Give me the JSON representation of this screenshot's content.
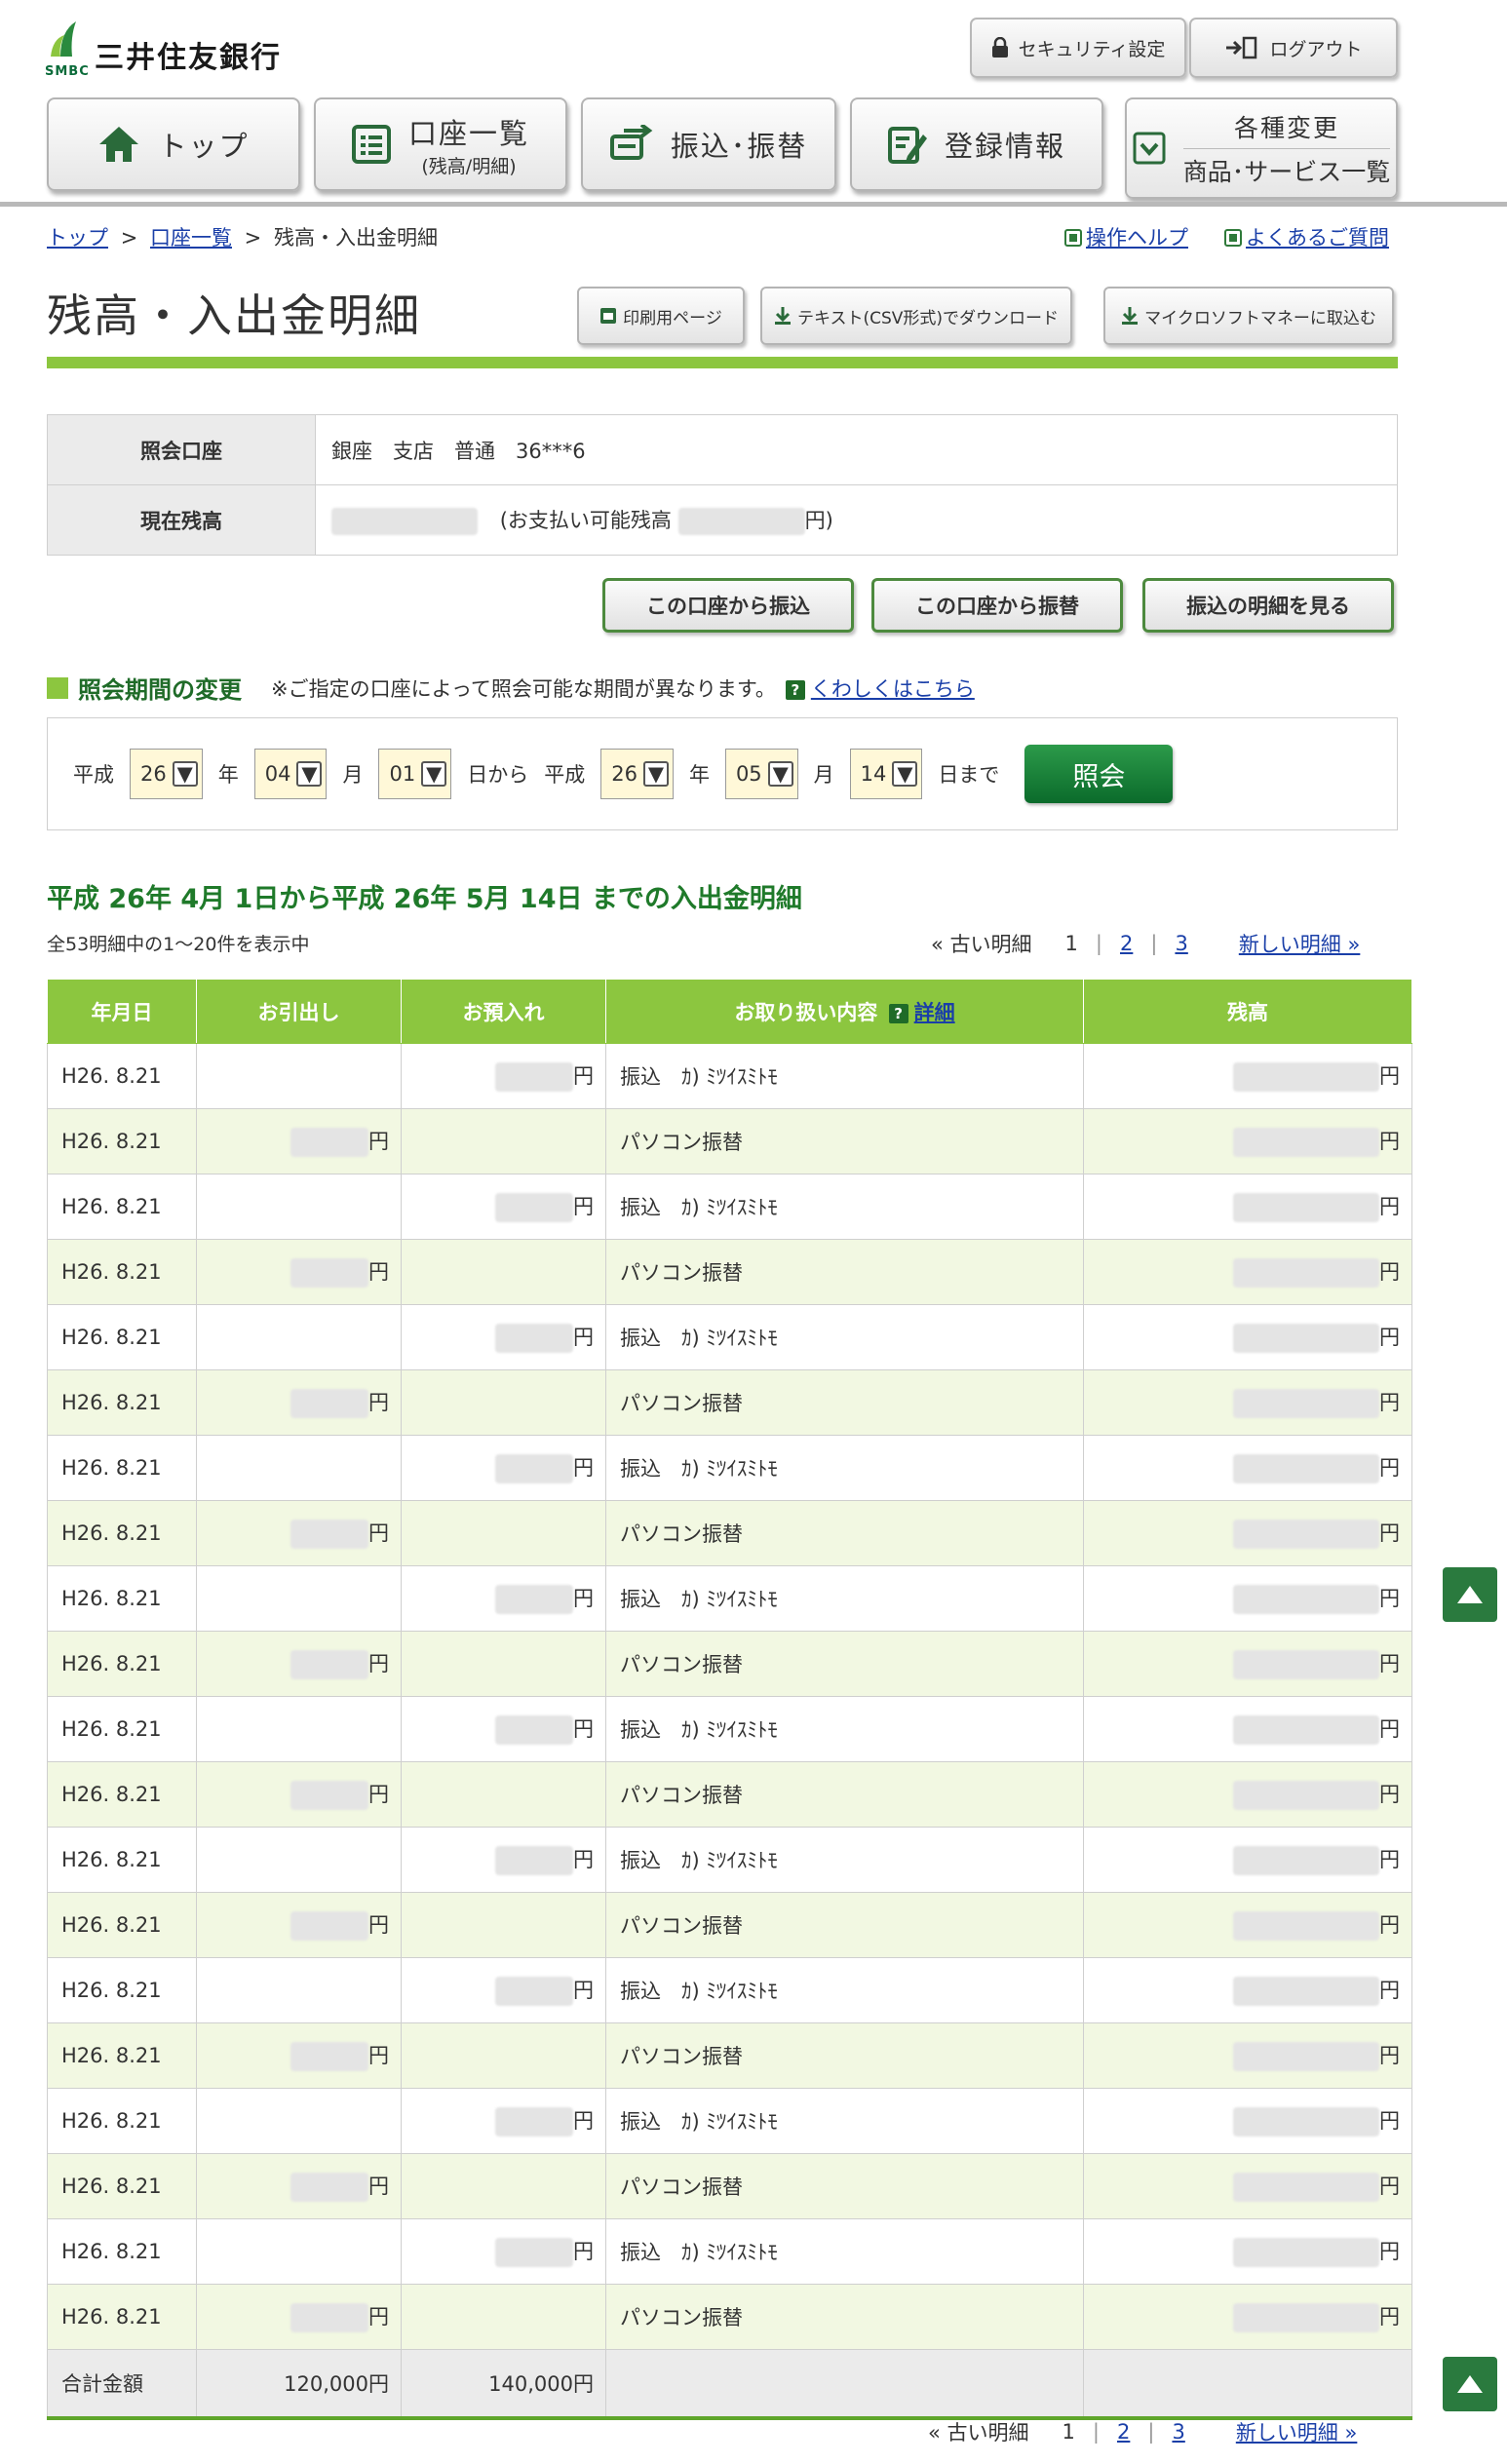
{
  "bank": {
    "name": "三井住友銀行",
    "short": "SMBC"
  },
  "header": {
    "security_label": "セキュリティ設定",
    "logout_label": "ログアウト"
  },
  "nav": {
    "top": "トップ",
    "accounts": "口座一覧",
    "accounts_sub": "(残高/明細)",
    "transfer": "振込･振替",
    "registration": "登録情報",
    "changes": "各種変更",
    "products": "商品･サービス一覧"
  },
  "breadcrumb": {
    "top": "トップ",
    "accounts": "口座一覧",
    "current": "残高・入出金明細",
    "sep": ">"
  },
  "help": {
    "manual": "操作ヘルプ",
    "faq": "よくあるご質問"
  },
  "page": {
    "title": "残高・入出金明細"
  },
  "tools": {
    "print": "印刷用ページ",
    "csv": "テキスト(CSV形式)でダウンロード",
    "money": "マイクロソフトマネーに取込む"
  },
  "account": {
    "account_label": "照会口座",
    "account_value": "銀座　支店　普通　36***6",
    "balance_label": "現在残高",
    "available_prefix": "(お支払い可能残高",
    "available_suffix": "円)"
  },
  "actions": {
    "transfer": "この口座から振込",
    "furikae": "この口座から振替",
    "history": "振込の明細を見る"
  },
  "period": {
    "title": "照会期間の変更",
    "note": "※ご指定の口座によって照会可能な期間が異なります。",
    "help_link": "くわしくはこちら",
    "era": "平成",
    "year_unit": "年",
    "month_unit": "月",
    "from_unit": "日から",
    "to_unit": "日まで",
    "from_year": "26",
    "from_month": "04",
    "from_day": "01",
    "to_year": "26",
    "to_month": "05",
    "to_day": "14",
    "submit": "照会"
  },
  "statement": {
    "title": "平成 26年 4月 1日から平成 26年 5月 14日 までの入出金明細",
    "count": "全53明細中の1～20件を表示中",
    "older": "« 古い明細",
    "newer": "新しい明細 »",
    "pages": [
      "1",
      "2",
      "3"
    ]
  },
  "table": {
    "headers": {
      "date": "年月日",
      "withdraw": "お引出し",
      "deposit": "お預入れ",
      "detail": "お取り扱い内容",
      "detail_link": "詳細",
      "balance": "残高"
    },
    "yen": "円",
    "rows": [
      {
        "date": "H26. 8.21",
        "type": "deposit",
        "desc": "振込　ｶ) ﾐﾂｲｽﾐﾄﾓ"
      },
      {
        "date": "H26. 8.21",
        "type": "withdraw",
        "desc": "パソコン振替"
      },
      {
        "date": "H26. 8.21",
        "type": "deposit",
        "desc": "振込　ｶ) ﾐﾂｲｽﾐﾄﾓ"
      },
      {
        "date": "H26. 8.21",
        "type": "withdraw",
        "desc": "パソコン振替"
      },
      {
        "date": "H26. 8.21",
        "type": "deposit",
        "desc": "振込　ｶ) ﾐﾂｲｽﾐﾄﾓ"
      },
      {
        "date": "H26. 8.21",
        "type": "withdraw",
        "desc": "パソコン振替"
      },
      {
        "date": "H26. 8.21",
        "type": "deposit",
        "desc": "振込　ｶ) ﾐﾂｲｽﾐﾄﾓ"
      },
      {
        "date": "H26. 8.21",
        "type": "withdraw",
        "desc": "パソコン振替"
      },
      {
        "date": "H26. 8.21",
        "type": "deposit",
        "desc": "振込　ｶ) ﾐﾂｲｽﾐﾄﾓ"
      },
      {
        "date": "H26. 8.21",
        "type": "withdraw",
        "desc": "パソコン振替"
      },
      {
        "date": "H26. 8.21",
        "type": "deposit",
        "desc": "振込　ｶ) ﾐﾂｲｽﾐﾄﾓ"
      },
      {
        "date": "H26. 8.21",
        "type": "withdraw",
        "desc": "パソコン振替"
      },
      {
        "date": "H26. 8.21",
        "type": "deposit",
        "desc": "振込　ｶ) ﾐﾂｲｽﾐﾄﾓ"
      },
      {
        "date": "H26. 8.21",
        "type": "withdraw",
        "desc": "パソコン振替"
      },
      {
        "date": "H26. 8.21",
        "type": "deposit",
        "desc": "振込　ｶ) ﾐﾂｲｽﾐﾄﾓ"
      },
      {
        "date": "H26. 8.21",
        "type": "withdraw",
        "desc": "パソコン振替"
      },
      {
        "date": "H26. 8.21",
        "type": "deposit",
        "desc": "振込　ｶ) ﾐﾂｲｽﾐﾄﾓ"
      },
      {
        "date": "H26. 8.21",
        "type": "withdraw",
        "desc": "パソコン振替"
      },
      {
        "date": "H26. 8.21",
        "type": "deposit",
        "desc": "振込　ｶ) ﾐﾂｲｽﾐﾄﾓ"
      },
      {
        "date": "H26. 8.21",
        "type": "withdraw",
        "desc": "パソコン振替"
      }
    ],
    "total": {
      "label": "合計金額",
      "withdraw": "120,000円",
      "deposit": "140,000円"
    }
  },
  "colors": {
    "accent": "#8cc63f",
    "dark_green": "#1f6b28",
    "alt_row": "#f2f8e2"
  }
}
